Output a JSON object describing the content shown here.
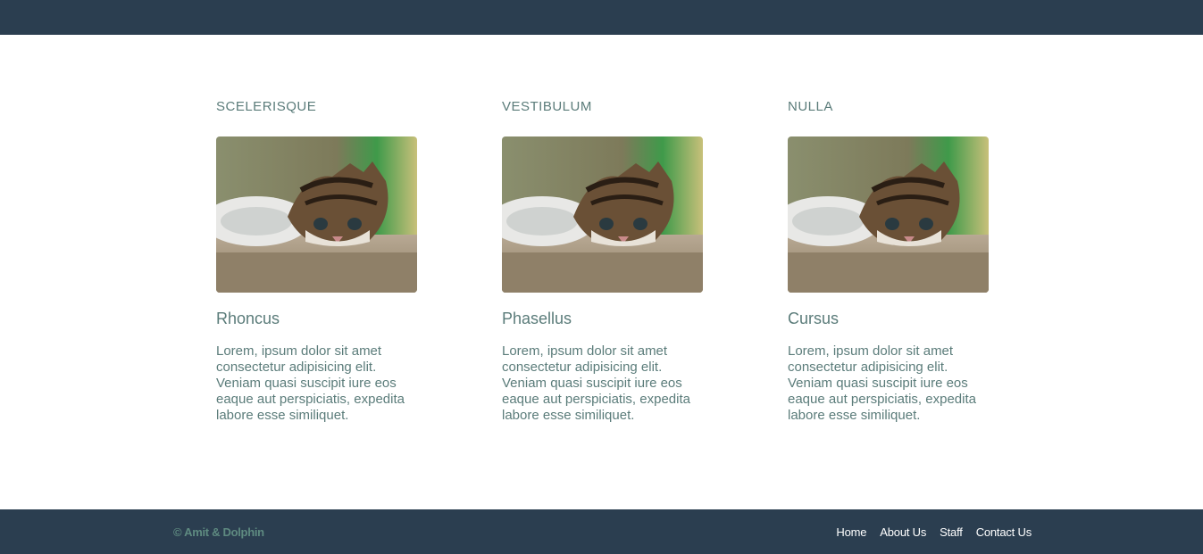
{
  "columns": [
    {
      "heading": "SCELERISQUE",
      "title": "Rhoncus",
      "text": "Lorem, ipsum dolor sit amet consectetur adipisicing elit. Veniam quasi suscipit iure eos eaque aut perspiciatis, expedita labore esse similiquet."
    },
    {
      "heading": "VESTIBULUM",
      "title": "Phasellus",
      "text": "Lorem, ipsum dolor sit amet consectetur adipisicing elit. Veniam quasi suscipit iure eos eaque aut perspiciatis, expedita labore esse similiquet."
    },
    {
      "heading": "NULLA",
      "title": "Cursus",
      "text": "Lorem, ipsum dolor sit amet consectetur adipisicing elit. Veniam quasi suscipit iure eos eaque aut perspiciatis, expedita labore esse similiquet."
    }
  ],
  "footer": {
    "copyright": "© Amit & Dolphin",
    "nav": [
      "Home",
      "About Us",
      "Staff",
      "Contact Us"
    ]
  },
  "colors": {
    "bar": "#2b3e50",
    "text": "#5b7c7a",
    "copyright": "#5e8a80"
  },
  "image": {
    "subject": "kitten-photo"
  }
}
